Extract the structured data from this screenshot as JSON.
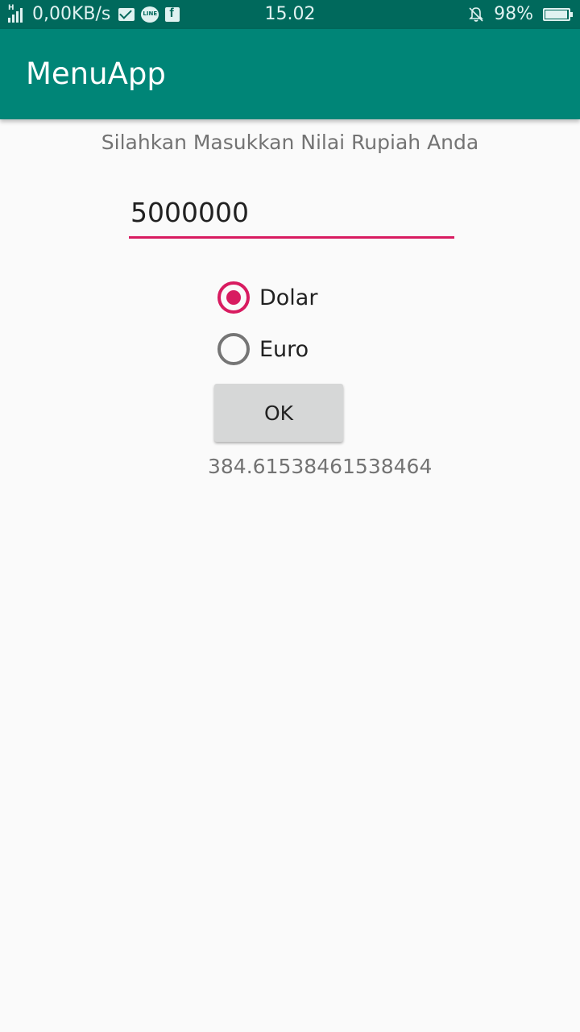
{
  "status_bar": {
    "network_type": "H",
    "speed": "0,00KB/s",
    "time": "15.02",
    "battery_percent": "98%",
    "battery_level": 0.98,
    "notifications": [
      "mail-icon",
      "line-icon",
      "facebook-icon"
    ]
  },
  "app_bar": {
    "title": "MenuApp",
    "color": "#008577"
  },
  "form": {
    "prompt": "Silahkan Masukkan Nilai Rupiah Anda",
    "amount_value": "5000000",
    "options": [
      {
        "label": "Dolar",
        "checked": true
      },
      {
        "label": "Euro",
        "checked": false
      }
    ],
    "ok_label": "OK",
    "result": "384.61538461538464",
    "accent_color": "#d81b60"
  }
}
